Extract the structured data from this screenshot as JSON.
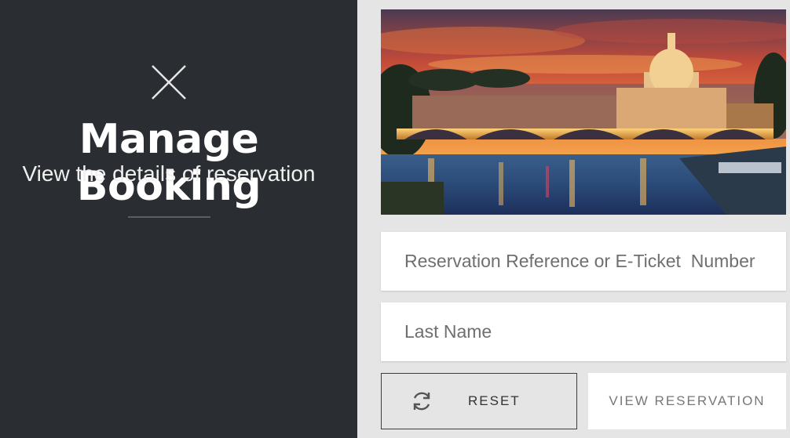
{
  "sidebar": {
    "title": "Manage Booking",
    "subtitle": "View the details of reservation",
    "close_icon": "close-icon"
  },
  "form": {
    "reference_placeholder": "Reservation Reference or E-Ticket  Number",
    "lastname_placeholder": "Last Name",
    "reset_label": "RESET",
    "reset_icon": "refresh-icon",
    "view_label": "VIEW RESERVATION"
  },
  "colors": {
    "sidebar_bg": "#2a2d31",
    "page_bg": "#e5e5e5",
    "field_bg": "#ffffff"
  }
}
